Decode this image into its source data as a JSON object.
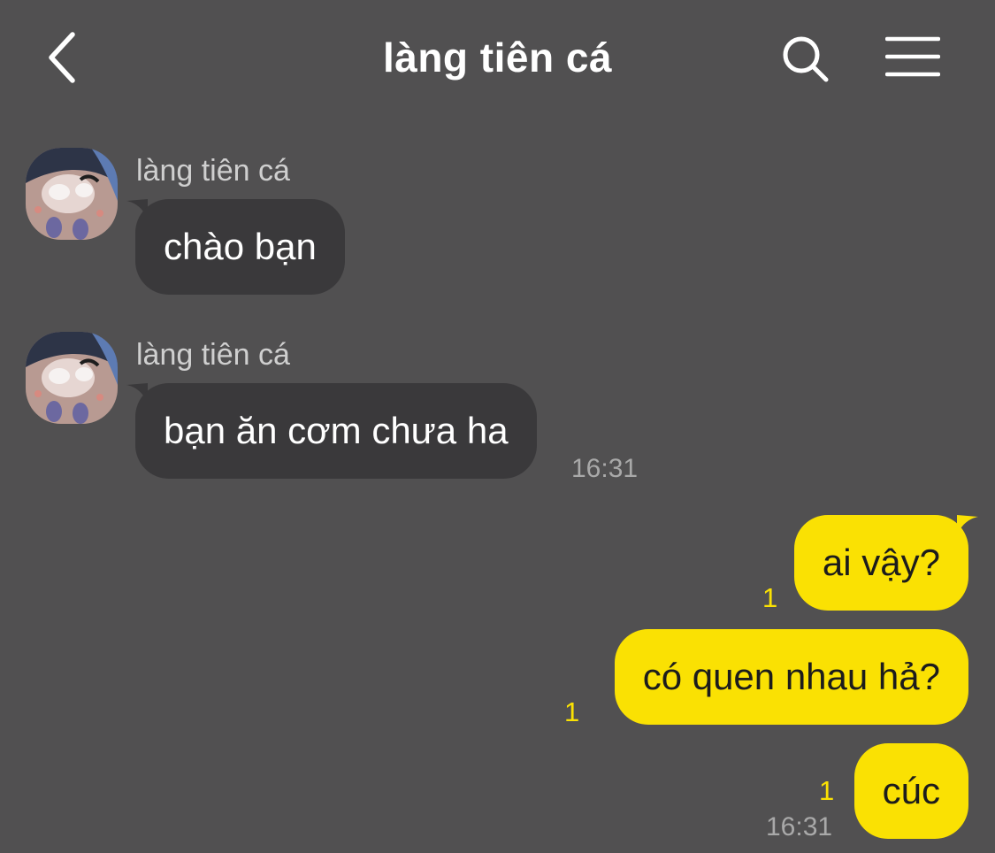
{
  "header": {
    "title": "làng tiên cá",
    "back_icon": "chevron-left-icon",
    "search_icon": "search-icon",
    "menu_icon": "hamburger-menu-icon"
  },
  "colors": {
    "background": "#515051",
    "incoming_bubble": "#3a393b",
    "outgoing_bubble": "#fae103",
    "unread_count": "#fae103",
    "timestamp": "#a9a9a9"
  },
  "messages": [
    {
      "direction": "incoming",
      "sender": "làng tiên cá",
      "text": "chào bạn"
    },
    {
      "direction": "incoming",
      "sender": "làng tiên cá",
      "text": "bạn ăn cơm chưa ha",
      "time": "16:31"
    },
    {
      "direction": "outgoing",
      "text": "ai vậy?",
      "unread": "1"
    },
    {
      "direction": "outgoing",
      "text": "có quen nhau hả?",
      "unread": "1"
    },
    {
      "direction": "outgoing",
      "text": "cúc",
      "unread": "1",
      "time": "16:31"
    }
  ]
}
